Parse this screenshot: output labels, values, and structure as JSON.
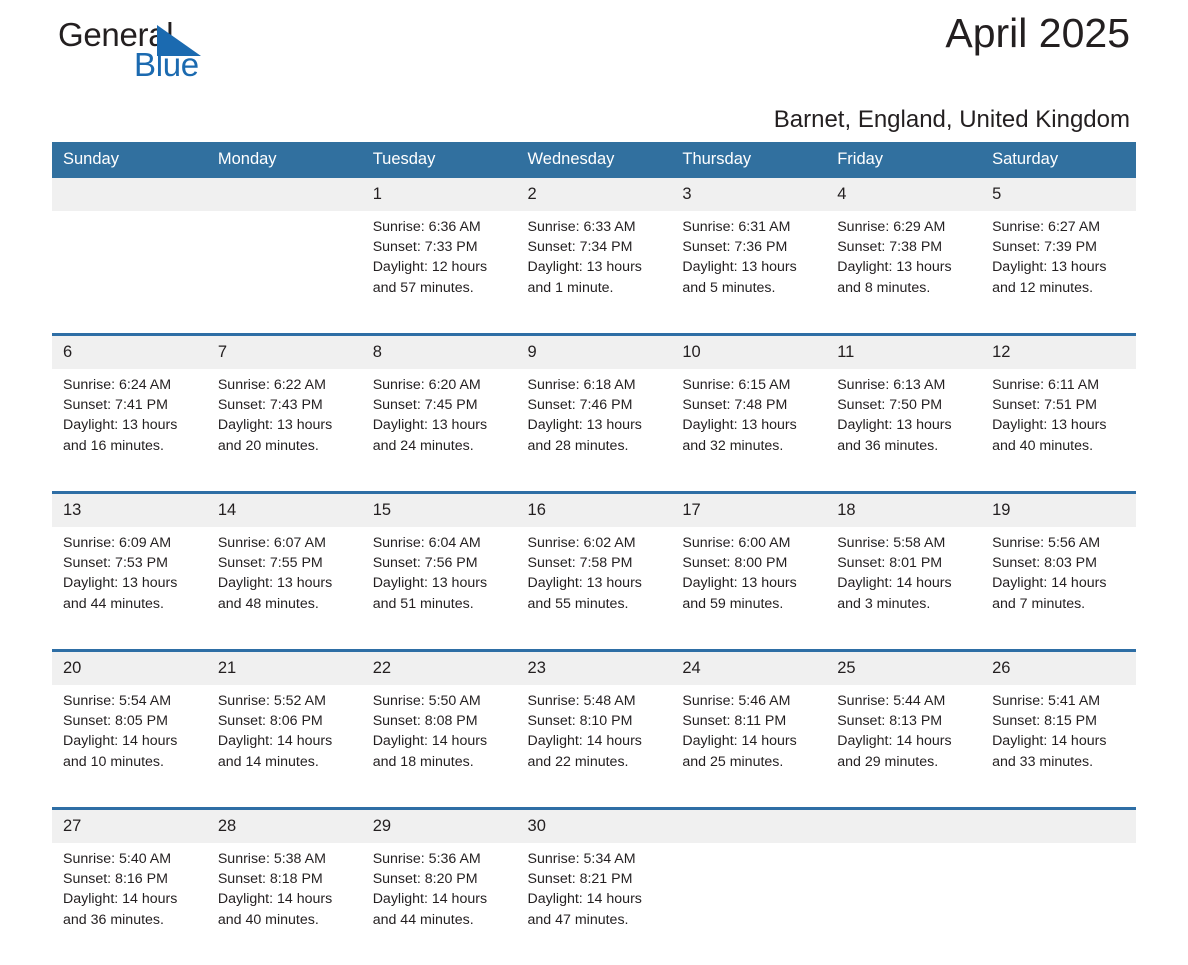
{
  "brand": {
    "name_part1": "General",
    "name_part2": "Blue",
    "triangle_color": "#1b6ab0"
  },
  "header": {
    "title": "April 2025",
    "location": "Barnet, England, United Kingdom"
  },
  "theme": {
    "header_blue": "#31709f",
    "separator_blue": "#2e6ea5",
    "daynum_bg": "#f0f0f0",
    "text": "#231f20"
  },
  "weekday_headers": [
    "Sunday",
    "Monday",
    "Tuesday",
    "Wednesday",
    "Thursday",
    "Friday",
    "Saturday"
  ],
  "weeks": [
    [
      {
        "day": "",
        "sunrise": "",
        "sunset": "",
        "daylight1": "",
        "daylight2": ""
      },
      {
        "day": "",
        "sunrise": "",
        "sunset": "",
        "daylight1": "",
        "daylight2": ""
      },
      {
        "day": "1",
        "sunrise": "Sunrise: 6:36 AM",
        "sunset": "Sunset: 7:33 PM",
        "daylight1": "Daylight: 12 hours",
        "daylight2": "and 57 minutes."
      },
      {
        "day": "2",
        "sunrise": "Sunrise: 6:33 AM",
        "sunset": "Sunset: 7:34 PM",
        "daylight1": "Daylight: 13 hours",
        "daylight2": "and 1 minute."
      },
      {
        "day": "3",
        "sunrise": "Sunrise: 6:31 AM",
        "sunset": "Sunset: 7:36 PM",
        "daylight1": "Daylight: 13 hours",
        "daylight2": "and 5 minutes."
      },
      {
        "day": "4",
        "sunrise": "Sunrise: 6:29 AM",
        "sunset": "Sunset: 7:38 PM",
        "daylight1": "Daylight: 13 hours",
        "daylight2": "and 8 minutes."
      },
      {
        "day": "5",
        "sunrise": "Sunrise: 6:27 AM",
        "sunset": "Sunset: 7:39 PM",
        "daylight1": "Daylight: 13 hours",
        "daylight2": "and 12 minutes."
      }
    ],
    [
      {
        "day": "6",
        "sunrise": "Sunrise: 6:24 AM",
        "sunset": "Sunset: 7:41 PM",
        "daylight1": "Daylight: 13 hours",
        "daylight2": "and 16 minutes."
      },
      {
        "day": "7",
        "sunrise": "Sunrise: 6:22 AM",
        "sunset": "Sunset: 7:43 PM",
        "daylight1": "Daylight: 13 hours",
        "daylight2": "and 20 minutes."
      },
      {
        "day": "8",
        "sunrise": "Sunrise: 6:20 AM",
        "sunset": "Sunset: 7:45 PM",
        "daylight1": "Daylight: 13 hours",
        "daylight2": "and 24 minutes."
      },
      {
        "day": "9",
        "sunrise": "Sunrise: 6:18 AM",
        "sunset": "Sunset: 7:46 PM",
        "daylight1": "Daylight: 13 hours",
        "daylight2": "and 28 minutes."
      },
      {
        "day": "10",
        "sunrise": "Sunrise: 6:15 AM",
        "sunset": "Sunset: 7:48 PM",
        "daylight1": "Daylight: 13 hours",
        "daylight2": "and 32 minutes."
      },
      {
        "day": "11",
        "sunrise": "Sunrise: 6:13 AM",
        "sunset": "Sunset: 7:50 PM",
        "daylight1": "Daylight: 13 hours",
        "daylight2": "and 36 minutes."
      },
      {
        "day": "12",
        "sunrise": "Sunrise: 6:11 AM",
        "sunset": "Sunset: 7:51 PM",
        "daylight1": "Daylight: 13 hours",
        "daylight2": "and 40 minutes."
      }
    ],
    [
      {
        "day": "13",
        "sunrise": "Sunrise: 6:09 AM",
        "sunset": "Sunset: 7:53 PM",
        "daylight1": "Daylight: 13 hours",
        "daylight2": "and 44 minutes."
      },
      {
        "day": "14",
        "sunrise": "Sunrise: 6:07 AM",
        "sunset": "Sunset: 7:55 PM",
        "daylight1": "Daylight: 13 hours",
        "daylight2": "and 48 minutes."
      },
      {
        "day": "15",
        "sunrise": "Sunrise: 6:04 AM",
        "sunset": "Sunset: 7:56 PM",
        "daylight1": "Daylight: 13 hours",
        "daylight2": "and 51 minutes."
      },
      {
        "day": "16",
        "sunrise": "Sunrise: 6:02 AM",
        "sunset": "Sunset: 7:58 PM",
        "daylight1": "Daylight: 13 hours",
        "daylight2": "and 55 minutes."
      },
      {
        "day": "17",
        "sunrise": "Sunrise: 6:00 AM",
        "sunset": "Sunset: 8:00 PM",
        "daylight1": "Daylight: 13 hours",
        "daylight2": "and 59 minutes."
      },
      {
        "day": "18",
        "sunrise": "Sunrise: 5:58 AM",
        "sunset": "Sunset: 8:01 PM",
        "daylight1": "Daylight: 14 hours",
        "daylight2": "and 3 minutes."
      },
      {
        "day": "19",
        "sunrise": "Sunrise: 5:56 AM",
        "sunset": "Sunset: 8:03 PM",
        "daylight1": "Daylight: 14 hours",
        "daylight2": "and 7 minutes."
      }
    ],
    [
      {
        "day": "20",
        "sunrise": "Sunrise: 5:54 AM",
        "sunset": "Sunset: 8:05 PM",
        "daylight1": "Daylight: 14 hours",
        "daylight2": "and 10 minutes."
      },
      {
        "day": "21",
        "sunrise": "Sunrise: 5:52 AM",
        "sunset": "Sunset: 8:06 PM",
        "daylight1": "Daylight: 14 hours",
        "daylight2": "and 14 minutes."
      },
      {
        "day": "22",
        "sunrise": "Sunrise: 5:50 AM",
        "sunset": "Sunset: 8:08 PM",
        "daylight1": "Daylight: 14 hours",
        "daylight2": "and 18 minutes."
      },
      {
        "day": "23",
        "sunrise": "Sunrise: 5:48 AM",
        "sunset": "Sunset: 8:10 PM",
        "daylight1": "Daylight: 14 hours",
        "daylight2": "and 22 minutes."
      },
      {
        "day": "24",
        "sunrise": "Sunrise: 5:46 AM",
        "sunset": "Sunset: 8:11 PM",
        "daylight1": "Daylight: 14 hours",
        "daylight2": "and 25 minutes."
      },
      {
        "day": "25",
        "sunrise": "Sunrise: 5:44 AM",
        "sunset": "Sunset: 8:13 PM",
        "daylight1": "Daylight: 14 hours",
        "daylight2": "and 29 minutes."
      },
      {
        "day": "26",
        "sunrise": "Sunrise: 5:41 AM",
        "sunset": "Sunset: 8:15 PM",
        "daylight1": "Daylight: 14 hours",
        "daylight2": "and 33 minutes."
      }
    ],
    [
      {
        "day": "27",
        "sunrise": "Sunrise: 5:40 AM",
        "sunset": "Sunset: 8:16 PM",
        "daylight1": "Daylight: 14 hours",
        "daylight2": "and 36 minutes."
      },
      {
        "day": "28",
        "sunrise": "Sunrise: 5:38 AM",
        "sunset": "Sunset: 8:18 PM",
        "daylight1": "Daylight: 14 hours",
        "daylight2": "and 40 minutes."
      },
      {
        "day": "29",
        "sunrise": "Sunrise: 5:36 AM",
        "sunset": "Sunset: 8:20 PM",
        "daylight1": "Daylight: 14 hours",
        "daylight2": "and 44 minutes."
      },
      {
        "day": "30",
        "sunrise": "Sunrise: 5:34 AM",
        "sunset": "Sunset: 8:21 PM",
        "daylight1": "Daylight: 14 hours",
        "daylight2": "and 47 minutes."
      },
      {
        "day": "",
        "sunrise": "",
        "sunset": "",
        "daylight1": "",
        "daylight2": ""
      },
      {
        "day": "",
        "sunrise": "",
        "sunset": "",
        "daylight1": "",
        "daylight2": ""
      },
      {
        "day": "",
        "sunrise": "",
        "sunset": "",
        "daylight1": "",
        "daylight2": ""
      }
    ]
  ]
}
